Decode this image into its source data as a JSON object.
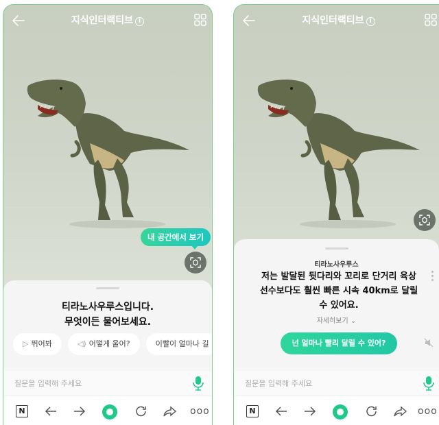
{
  "app": {
    "title": "지식인터랙티브",
    "info_mark": "i"
  },
  "left_screen": {
    "ar_button_label": "내 공간에서 보기",
    "greeting_line1": "티라노사우루스입니다.",
    "greeting_line2": "무엇이든 물어보세요.",
    "chips": [
      {
        "icon": "play-outline-icon",
        "label": "뛰어봐"
      },
      {
        "icon": "speaker-icon",
        "label": "어떻게 울어?"
      },
      {
        "icon": "none",
        "label": "이빨이 얼마나 길"
      }
    ],
    "input_placeholder": "질문을 입력해 주세요"
  },
  "right_screen": {
    "dino_name": "티라노사우루스",
    "answer": "저는 발달된 뒷다리와 꼬리로 단거리 육상선수보다도 훨씬 빠른 시속 40km로 달릴 수 있어요.",
    "more_label": "자세히보기",
    "suggestion": "넌 얼마나 빨리 달릴 수 있어?",
    "input_placeholder": "질문을 입력해 주세요"
  },
  "navbar": {
    "logo_letter": "N",
    "more_label": "ooo"
  },
  "colors": {
    "accent_green": "#1ec98a",
    "ar_gradient_start": "#37d59b",
    "ar_gradient_end": "#1ec6c0",
    "border_green": "#7ccf8b"
  }
}
